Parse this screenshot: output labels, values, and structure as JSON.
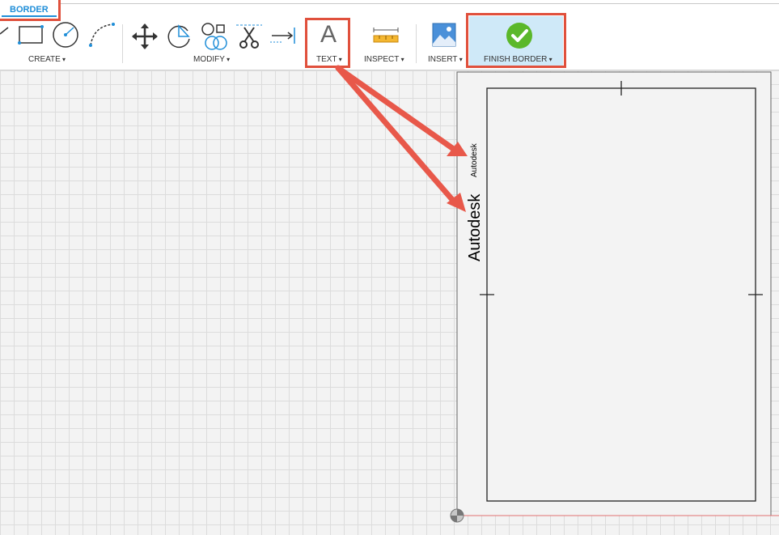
{
  "tab": {
    "label": "BORDER"
  },
  "groups": {
    "create": "CREATE",
    "modify": "MODIFY",
    "text": "TEXT",
    "inspect": "INSPECT",
    "insert": "INSERT",
    "finish": "FINISH BORDER"
  },
  "text_tool_icon_glyph": "A",
  "canvas": {
    "small_text": "Autodesk",
    "large_text": "Autodesk"
  },
  "colors": {
    "accent": "#1f8ed8",
    "highlight": "#e0503c",
    "finish_bg": "#cfe9f8",
    "finish_check": "#5bb82a"
  }
}
